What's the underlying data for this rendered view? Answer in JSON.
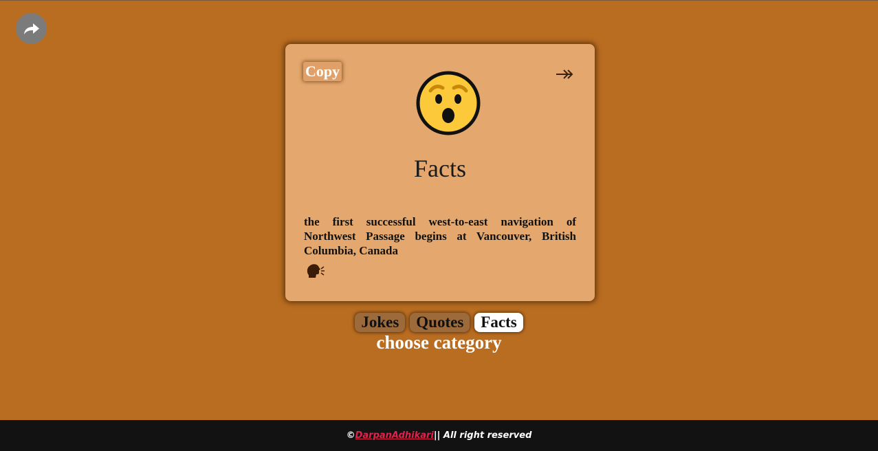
{
  "share": {
    "icon": "share-arrow-icon"
  },
  "card": {
    "copy_label": "Copy",
    "next_icon": "double-arrow-right-icon",
    "emoji_icon": "surprised-face-icon",
    "title": "Facts",
    "text": "the first successful west-to-east navigation of Northwest Passage begins at Vancouver, British Columbia, Canada",
    "speak_icon": "speaking-head-icon"
  },
  "categories": [
    {
      "label": "Jokes",
      "active": false
    },
    {
      "label": "Quotes",
      "active": false
    },
    {
      "label": "Facts",
      "active": true
    }
  ],
  "choose_label": "choose category",
  "footer": {
    "copyright": "©",
    "author": " DarpanAdhikari",
    "rights": " || All right reserved"
  },
  "colors": {
    "background": "#b96d21",
    "card": "#e4a86e",
    "footer": "#121212",
    "link": "#e0234b"
  }
}
